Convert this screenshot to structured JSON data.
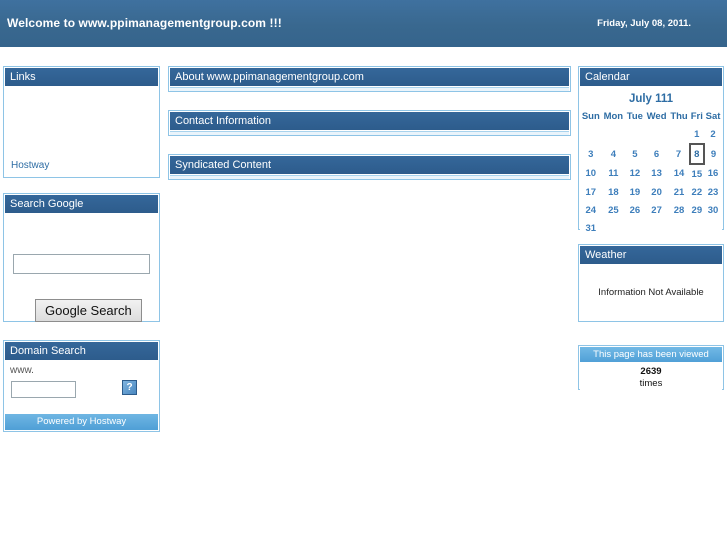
{
  "banner": {
    "title": "Welcome to www.ppimanagementgroup.com !!!",
    "date": "Friday, July 08, 2011."
  },
  "links_panel": {
    "header": "Links",
    "items": [
      {
        "label": "Hostway"
      }
    ]
  },
  "google_panel": {
    "header": "Search Google",
    "input_value": "",
    "input_placeholder": "",
    "button_label": "Google Search"
  },
  "domain_panel": {
    "header": "Domain Search",
    "www_label": "www.",
    "input_value": "",
    "input_placeholder": "",
    "broken_image_glyph": "?",
    "footer": "Powered by Hostway"
  },
  "center_panels": [
    {
      "header": "About www.ppimanagementgroup.com"
    },
    {
      "header": "Contact Information"
    },
    {
      "header": "Syndicated Content"
    }
  ],
  "calendar": {
    "header": "Calendar",
    "title": "July 111",
    "daynames": [
      "Sun",
      "Mon",
      "Tue",
      "Wed",
      "Thu",
      "Fri",
      "Sat"
    ],
    "today": 8,
    "weeks": [
      [
        "",
        "",
        "",
        "",
        "",
        "1",
        "2"
      ],
      [
        "3",
        "4",
        "5",
        "6",
        "7",
        "8",
        "9"
      ],
      [
        "10",
        "11",
        "12",
        "13",
        "14",
        "15",
        "16"
      ],
      [
        "17",
        "18",
        "19",
        "20",
        "21",
        "22",
        "23"
      ],
      [
        "24",
        "25",
        "26",
        "27",
        "28",
        "29",
        "30"
      ],
      [
        "31",
        "",
        "",
        "",
        "",
        "",
        ""
      ]
    ]
  },
  "weather": {
    "header": "Weather",
    "message": "Information Not Available"
  },
  "counter": {
    "header": "This page has been viewed",
    "count": "2639",
    "word": "times"
  },
  "colors": {
    "banner_blue": "#3a6d9e",
    "panel_header_blue": "#2f6090",
    "panel_border_blue": "#8ec4e6",
    "accent_light_blue": "#5aa9dd",
    "link_blue": "#2e6da4"
  }
}
